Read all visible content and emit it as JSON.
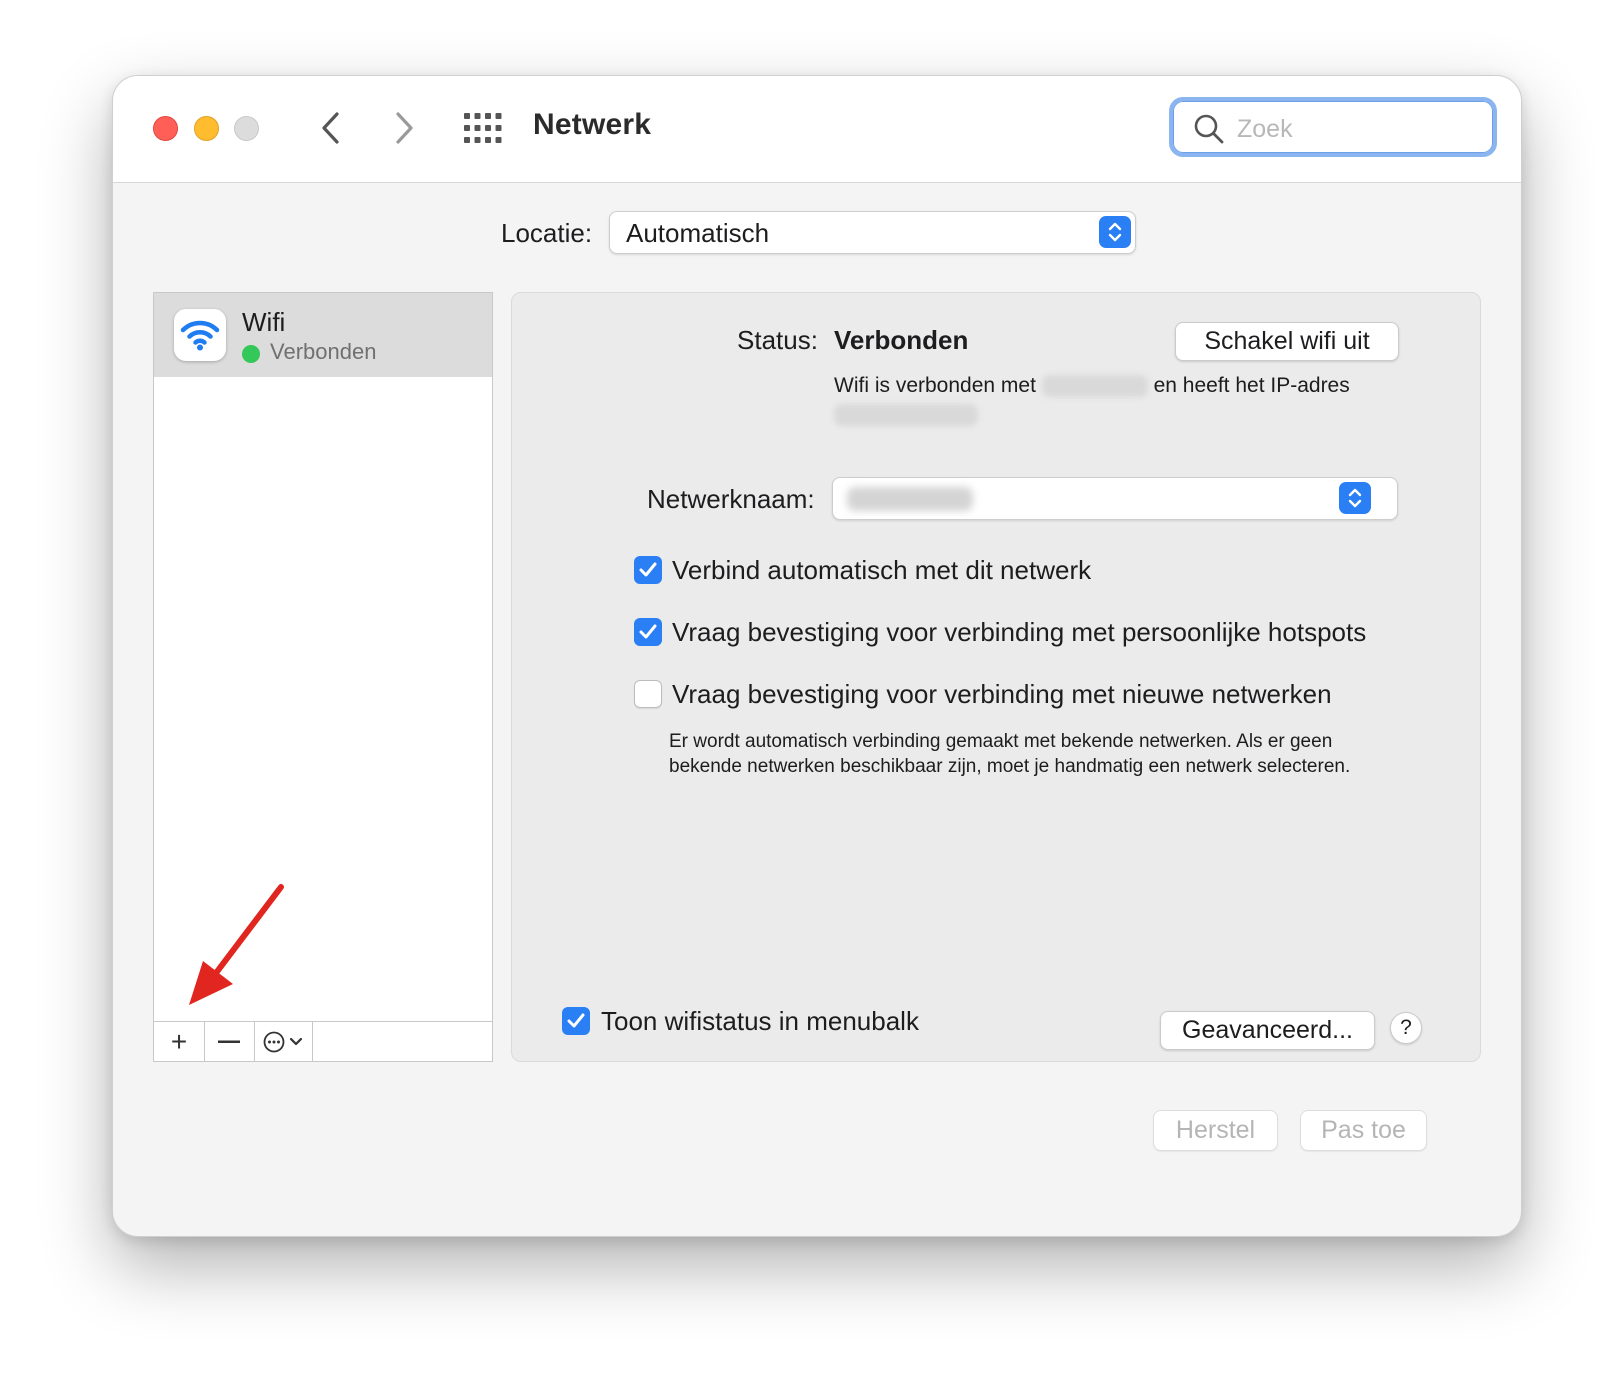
{
  "window": {
    "title": "Netwerk",
    "search": {
      "placeholder": "Zoek",
      "value": ""
    }
  },
  "location": {
    "label": "Locatie:",
    "value": "Automatisch"
  },
  "sidebar": {
    "items": [
      {
        "name": "Wifi",
        "status": "Verbonden",
        "status_color": "#34c759",
        "selected": true
      }
    ],
    "toolbar": {
      "add": "+",
      "remove": "—"
    }
  },
  "panel": {
    "status_label": "Status:",
    "status_value": "Verbonden",
    "wifi_off_button": "Schakel wifi uit",
    "description": {
      "prefix": "Wifi is verbonden met",
      "middle": "en heeft het IP-adres"
    },
    "network_name_label": "Netwerknaam:",
    "checkboxes": [
      {
        "label": "Verbind automatisch met dit netwerk",
        "checked": true
      },
      {
        "label": "Vraag bevestiging voor verbinding met persoonlijke hotspots",
        "checked": true
      },
      {
        "label": "Vraag bevestiging voor verbinding met nieuwe netwerken",
        "checked": false
      }
    ],
    "note": "Er wordt automatisch verbinding gemaakt met bekende netwerken. Als er geen bekende netwerken beschikbaar zijn, moet je handmatig een netwerk selecteren.",
    "menubar_checkbox": {
      "label": "Toon wifistatus in menubalk",
      "checked": true
    },
    "advanced_button": "Geavanceerd...",
    "help_button": "?"
  },
  "footer": {
    "revert_button": "Herstel",
    "apply_button": "Pas toe"
  },
  "colors": {
    "accent": "#2a7ff5",
    "annotation_arrow": "#e0261f"
  }
}
